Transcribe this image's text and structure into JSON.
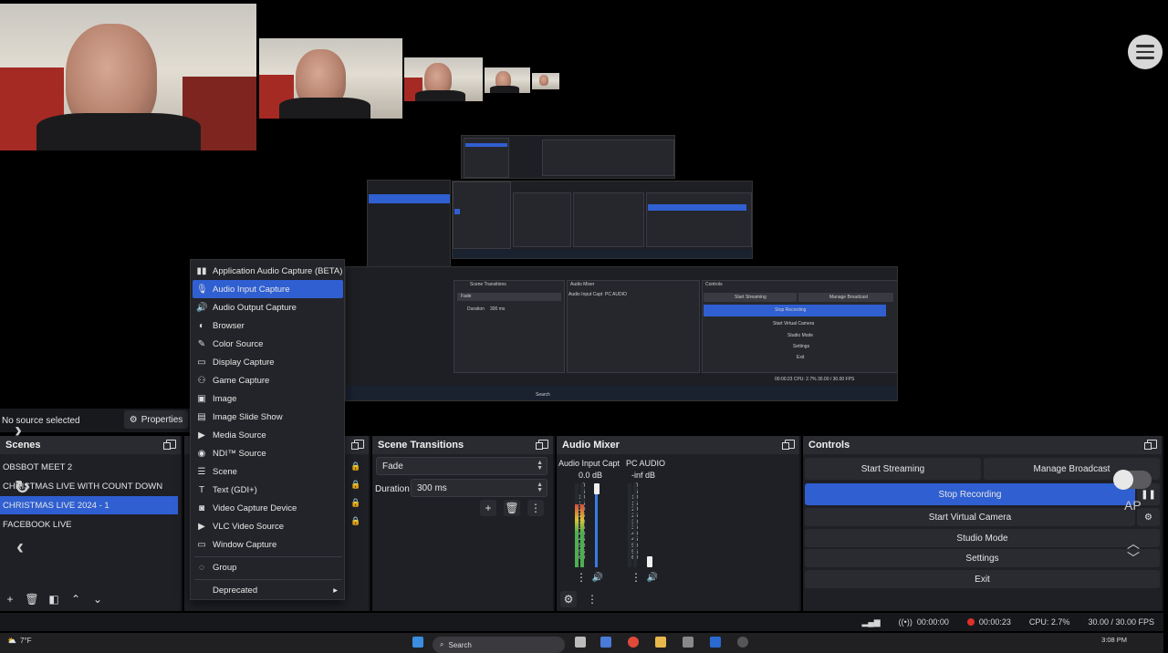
{
  "window": {
    "controls": [
      "—",
      "▢",
      "✕"
    ]
  },
  "preview": {
    "mini_menu": [
      "Application Audio Capture (BETA)",
      "Audio Input Capture",
      "Audio Output Capture",
      "Browser",
      "Color Source",
      "Display Capture",
      "Game Capture",
      "Image",
      "Image Slide Show",
      "Media Source",
      "NDI™ Source",
      "Scene",
      "Text (GDI+)",
      "Video Capture Device",
      "VLC Video Source",
      "Window Capture",
      "Group",
      "Deprecated"
    ],
    "mini_docks": {
      "transitions": "Scene Transitions",
      "mixer": "Audio Mixer",
      "controls": "Controls",
      "fade": "Fade",
      "duration_label": "Duration",
      "duration": "300 ms",
      "mixer_ch1": "Audio Input Capt",
      "mixer_ch2": "PC AUDIO"
    },
    "mini_buttons": [
      "Start Streaming",
      "Manage Broadcast",
      "Stop Recording",
      "Start Virtual Camera",
      "Studio Mode",
      "Settings",
      "Exit"
    ],
    "mini_status": "00:00:23   CPU: 2.7%   30.00 / 30.00 FPS",
    "mini_search": "Search"
  },
  "source_bar": {
    "no_source": "No source selected",
    "properties": "Properties"
  },
  "scenes": {
    "title": "Scenes",
    "items": [
      "OBSBOT MEET 2",
      "CHRISTMAS LIVE WITH COUNT DOWN",
      "CHRISTMAS LIVE 2024 - 1",
      "FACEBOOK LIVE"
    ],
    "active_index": 2
  },
  "context_menu": {
    "items": [
      {
        "label": "Application Audio Capture (BETA)",
        "icon": "▮▮"
      },
      {
        "label": "Audio Input Capture",
        "icon": "🎙"
      },
      {
        "label": "Audio Output Capture",
        "icon": "🔊"
      },
      {
        "label": "Browser",
        "icon": "◐"
      },
      {
        "label": "Color Source",
        "icon": "✎"
      },
      {
        "label": "Display Capture",
        "icon": "▭"
      },
      {
        "label": "Game Capture",
        "icon": "⚇"
      },
      {
        "label": "Image",
        "icon": "▣"
      },
      {
        "label": "Image Slide Show",
        "icon": "▤"
      },
      {
        "label": "Media Source",
        "icon": "▶"
      },
      {
        "label": "NDI™ Source",
        "icon": "◉"
      },
      {
        "label": "Scene",
        "icon": "☰"
      },
      {
        "label": "Text (GDI+)",
        "icon": "T"
      },
      {
        "label": "Video Capture Device",
        "icon": "◙"
      },
      {
        "label": "VLC Video Source",
        "icon": "▶"
      },
      {
        "label": "Window Capture",
        "icon": "▭"
      },
      {
        "label": "Group",
        "icon": "◌"
      },
      {
        "label": "Deprecated",
        "icon": ""
      }
    ],
    "active_index": 1
  },
  "transitions": {
    "title": "Scene Transitions",
    "type": "Fade",
    "duration_label": "Duration",
    "duration": "300 ms"
  },
  "mixer": {
    "title": "Audio Mixer",
    "channels": [
      {
        "name": "Audio Input Capt",
        "db": "0.0 dB",
        "level": 0.75
      },
      {
        "name": "PC AUDIO",
        "db": "-inf dB",
        "level": 0.0
      }
    ],
    "scale": [
      "0",
      "-5",
      "-10",
      "-15",
      "-20",
      "-25",
      "-30",
      "-35",
      "-40",
      "-45",
      "-50",
      "-55",
      "-60"
    ]
  },
  "controls": {
    "title": "Controls",
    "start_streaming": "Start Streaming",
    "manage_broadcast": "Manage Broadcast",
    "stop_recording": "Stop Recording",
    "start_virtual_camera": "Start Virtual Camera",
    "studio_mode": "Studio Mode",
    "settings": "Settings",
    "exit": "Exit",
    "overlay_label": "AP"
  },
  "status": {
    "stream_time": "00:00:00",
    "rec_time": "00:00:23",
    "cpu": "CPU: 2.7%",
    "fps": "30.00 / 30.00 FPS"
  },
  "taskbar": {
    "temp": "7°F",
    "search": "Search",
    "time": "3:08 PM"
  },
  "colors": {
    "accent": "#2f5fd1",
    "rec": "#e0302a",
    "bg": "#1f2026"
  }
}
